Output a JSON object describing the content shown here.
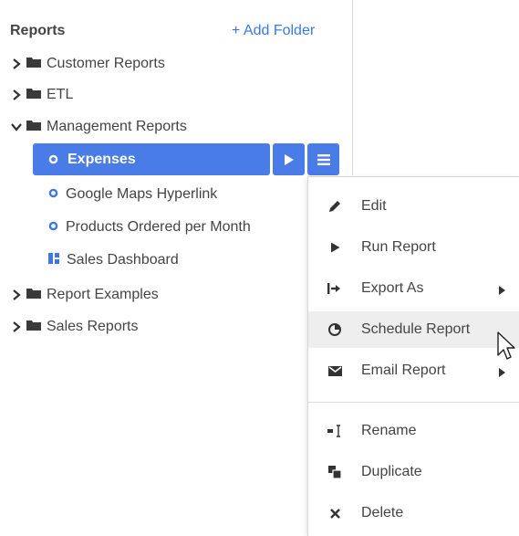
{
  "sidebar": {
    "title": "Reports",
    "add_folder": "+ Add Folder",
    "folders": [
      {
        "label": "Customer Reports"
      },
      {
        "label": "ETL"
      },
      {
        "label": "Management Reports"
      },
      {
        "label": "Report Examples"
      },
      {
        "label": "Sales Reports"
      }
    ],
    "management_items": [
      {
        "label": "Expenses"
      },
      {
        "label": "Google Maps Hyperlink"
      },
      {
        "label": "Products Ordered per Month"
      },
      {
        "label": "Sales Dashboard"
      }
    ]
  },
  "context_menu": {
    "items": [
      {
        "label": "Edit"
      },
      {
        "label": "Run Report"
      },
      {
        "label": "Export As"
      },
      {
        "label": "Schedule Report"
      },
      {
        "label": "Email Report"
      },
      {
        "label": "Rename"
      },
      {
        "label": "Duplicate"
      },
      {
        "label": "Delete"
      }
    ]
  },
  "colors": {
    "accent": "#4a7ce8",
    "link": "#3b78e7",
    "hover_bg": "#eeeeee"
  }
}
